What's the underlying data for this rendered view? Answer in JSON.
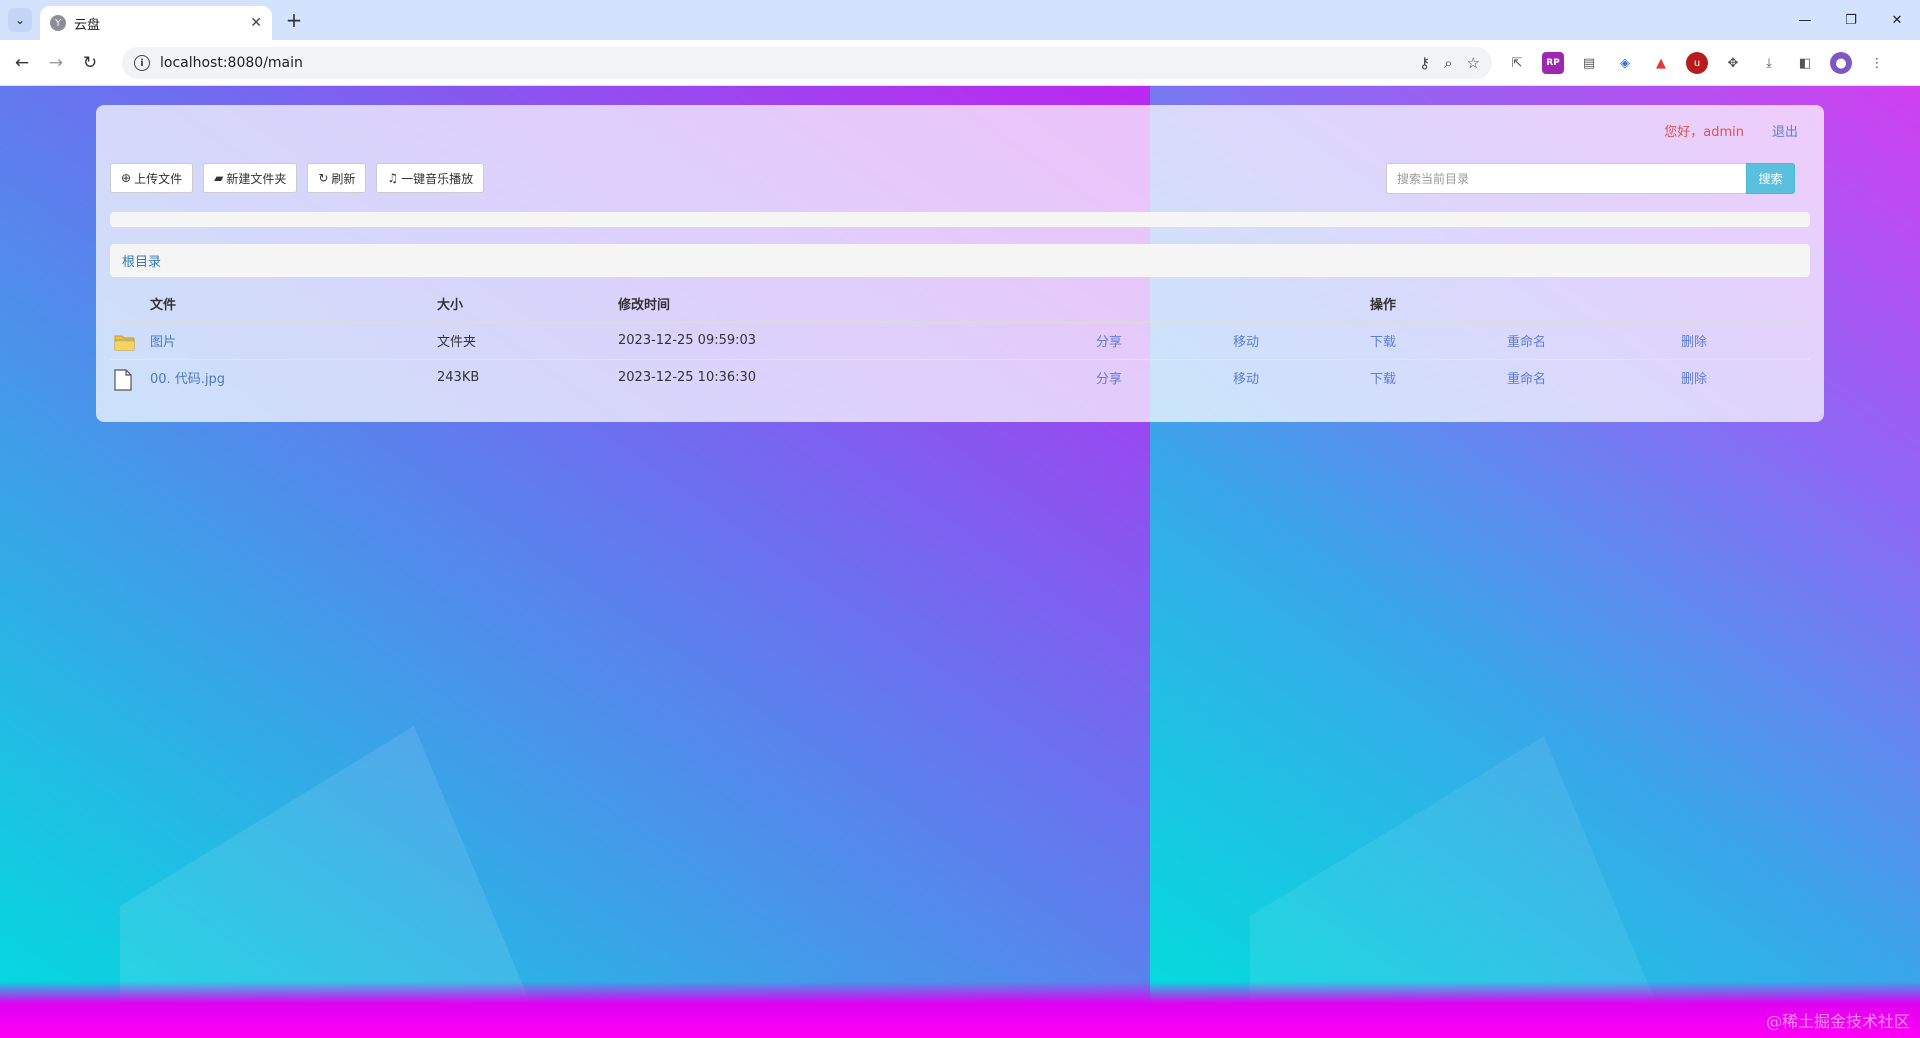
{
  "browser": {
    "tab_title": "云盘",
    "favicon_letter": "Y",
    "url": "localhost:8080/main",
    "new_tab_label": "+",
    "tab_close": "✕"
  },
  "header": {
    "greeting": "您好，admin",
    "logout": "退出"
  },
  "toolbar": {
    "upload": "上传文件",
    "new_folder": "新建文件夹",
    "refresh": "刷新",
    "play_music": "一键音乐播放"
  },
  "search": {
    "placeholder": "搜索当前目录",
    "button": "搜索"
  },
  "upload_progress": 0,
  "breadcrumb": {
    "root": "根目录"
  },
  "table": {
    "columns": {
      "file": "文件",
      "size": "大小",
      "modified": "修改时间",
      "actions": "操作"
    },
    "rows": [
      {
        "icon": "folder-icon",
        "name": "图片",
        "size": "文件夹",
        "modified": "2023-12-25 09:59:03",
        "share": "分享",
        "move": "移动",
        "download": "下载",
        "rename": "重命名",
        "delete": "删除"
      },
      {
        "icon": "file-icon",
        "name": "00. 代码.jpg",
        "size": "243KB",
        "modified": "2023-12-25 10:36:30",
        "share": "分享",
        "move": "移动",
        "download": "下载",
        "rename": "重命名",
        "delete": "删除"
      }
    ]
  },
  "watermark": "@稀土掘金技术社区",
  "colors": {
    "link": "#5b7fd0",
    "greeting": "#d9534f",
    "search_button": "#5bc0de",
    "tabstrip": "#d3e3fd"
  }
}
